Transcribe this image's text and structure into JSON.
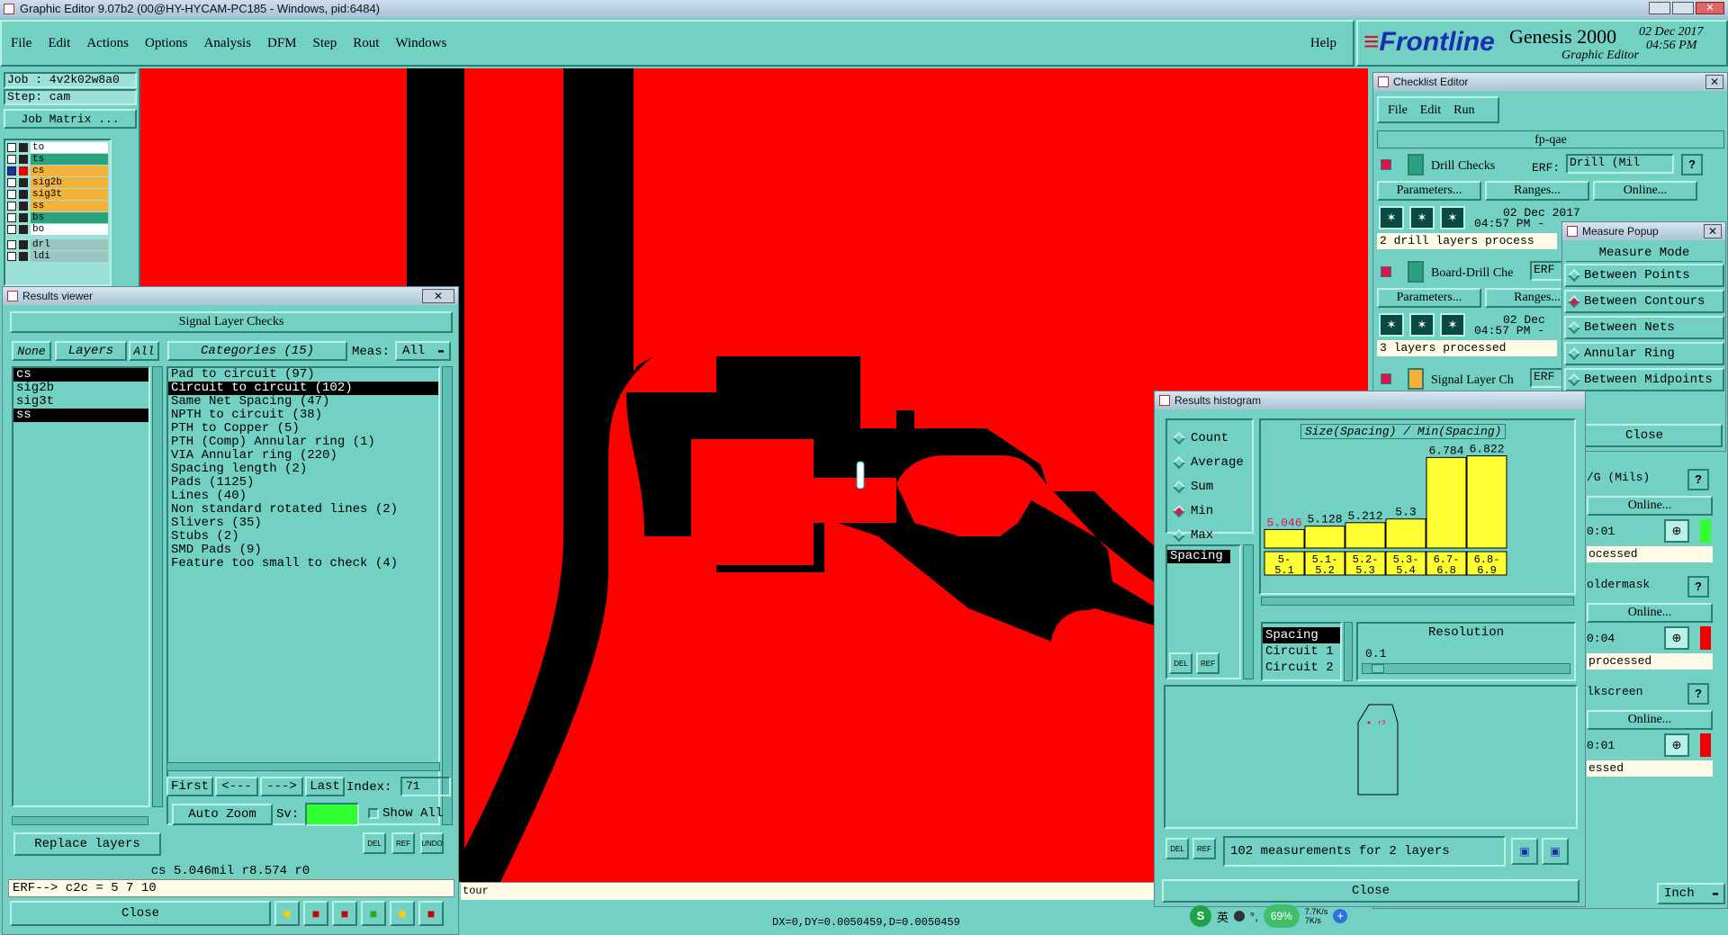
{
  "title_bar": {
    "text": "Graphic Editor 9.07b2 (00@HY-HYCAM-PC185 - Windows, pid:6484)"
  },
  "menu": {
    "items": [
      "File",
      "Edit",
      "Actions",
      "Options",
      "Analysis",
      "DFM",
      "Step",
      "Rout",
      "Windows"
    ],
    "help": "Help"
  },
  "brand": {
    "logo": "Frontline",
    "product": "Genesis 2000",
    "subtitle": "Graphic Editor",
    "date": "02 Dec 2017",
    "time": "04:56 PM"
  },
  "job": {
    "job_label": "Job : 4v2k02w8a0",
    "step_label": "Step: cam",
    "matrix_button": "Job Matrix ..."
  },
  "layers": [
    {
      "name": "to",
      "color": "#ffffff"
    },
    {
      "name": "ts",
      "color": "#2aa27e"
    },
    {
      "name": "cs",
      "color": "#f5b23a"
    },
    {
      "name": "sig2b",
      "color": "#f5b23a"
    },
    {
      "name": "sig3t",
      "color": "#f5b23a"
    },
    {
      "name": "ss",
      "color": "#f5b23a"
    },
    {
      "name": "bs",
      "color": "#2aa27e"
    },
    {
      "name": "bo",
      "color": "#ffffff"
    },
    {
      "name": "drl",
      "color": "#9bc6c0"
    },
    {
      "name": "ldi",
      "color": "#9bc6c0"
    }
  ],
  "results_viewer": {
    "window_title": "Results viewer",
    "header": "Signal Layer Checks",
    "none_btn": "None",
    "layers_btn": "Layers",
    "all_btn": "All",
    "categories_btn": "Categories (15)",
    "meas_label": "Meas:",
    "meas_value": "All",
    "layer_list": [
      "cs",
      "sig2b",
      "sig3t",
      "ss"
    ],
    "categories": [
      "Pad to circuit (97)",
      "Circuit to circuit (102)",
      "Same Net Spacing (47)",
      "NPTH to circuit (38)",
      "PTH to Copper (5)",
      "PTH (Comp) Annular ring (1)",
      "VIA Annular ring (220)",
      "Spacing length (2)",
      "Pads (1125)",
      "Lines (40)",
      "Non standard rotated lines (2)",
      "Slivers (35)",
      "Stubs (2)",
      "SMD Pads (9)",
      "Feature too small to check (4)"
    ],
    "first": "First",
    "prev": "<---",
    "next": "--->",
    "last": "Last",
    "index_label": "Index:",
    "index_value": "71",
    "auto_zoom": "Auto Zoom",
    "sv_label": "Sv:",
    "show_all": "Show All",
    "replace_layers": "Replace layers",
    "del": "DEL",
    "ref": "REF",
    "undo": "UNDO",
    "status": "cs 5.046mil  r8.574  r0",
    "erf_line": "ERF--> c2c = 5 7 10",
    "close": "Close"
  },
  "canvas": {
    "status_text": "tour",
    "coords": "DX=0,DY=0.0050459,D=0.0050459"
  },
  "checklist_editor": {
    "window_title": "Checklist Editor",
    "menu": [
      "File",
      "Edit",
      "Run"
    ],
    "checklist_name": "fp-qae",
    "erf_label": "ERF:",
    "parameters": "Parameters...",
    "ranges": "Ranges...",
    "online": "Online...",
    "checks": [
      {
        "name": "Drill Checks",
        "erf": "Drill (Mil",
        "date": "02 Dec 2017",
        "time": "04:57 PM -",
        "status": "2 drill layers process"
      },
      {
        "name": "Board-Drill Che",
        "erf": "ERF",
        "date": "02 Dec",
        "time": "04:57 PM -",
        "status": "3 layers processed"
      },
      {
        "name": "Signal Layer Ch",
        "erf": "ERF",
        "date": "",
        "time": "",
        "status": ""
      }
    ],
    "right_rows": [
      {
        "erf": "/G (Mils)",
        "time": "0:01",
        "status": "ocessed"
      },
      {
        "erf": "oldermask",
        "time": "0:04",
        "status": "processed"
      },
      {
        "erf": "lkscreen",
        "time": "0:01",
        "status": "essed"
      }
    ]
  },
  "measure_popup": {
    "window_title": "Measure Popup",
    "header": "Measure Mode",
    "modes": [
      {
        "label": "Between Points",
        "on": false
      },
      {
        "label": "Between Contours",
        "on": true
      },
      {
        "label": "Between Nets",
        "on": false
      },
      {
        "label": "Annular Ring",
        "on": false
      },
      {
        "label": "Between Midpoints",
        "on": false
      }
    ],
    "close": "Close"
  },
  "histogram": {
    "window_title": "Results histogram",
    "modes": [
      {
        "label": "Count",
        "on": false
      },
      {
        "label": "Average",
        "on": false
      },
      {
        "label": "Sum",
        "on": false
      },
      {
        "label": "Min",
        "on": true
      },
      {
        "label": "Max",
        "on": false
      }
    ],
    "chart_title": "Size(Spacing) / Min(Spacing)",
    "attr_list": [
      "Spacing"
    ],
    "field_list": [
      "Spacing",
      "Circuit 1",
      "Circuit 2"
    ],
    "resolution_label": "Resolution",
    "resolution_value": "0.1",
    "summary": "102 measurements for 2 layers",
    "close": "Close"
  },
  "chart_data": {
    "type": "bar",
    "title": "Size(Spacing) / Min(Spacing)",
    "categories": [
      "5-5.1",
      "5.1-5.2",
      "5.2-5.3",
      "5.3-5.4",
      "6.7-6.8",
      "6.8-6.9"
    ],
    "values": [
      5.046,
      5.128,
      5.212,
      5.3,
      6.784,
      6.822
    ],
    "value_labels": [
      "5.046",
      "5.128",
      "5.212",
      "5.3",
      "6.784",
      "6.822"
    ],
    "ylim": [
      4.6,
      6.9
    ],
    "bar_color": "#ffff33"
  },
  "bottom_right": {
    "units": "Inch"
  },
  "tray": {
    "ime": "英",
    "battery": "69%",
    "up": "7.7K/s",
    "down": "7K/s"
  }
}
